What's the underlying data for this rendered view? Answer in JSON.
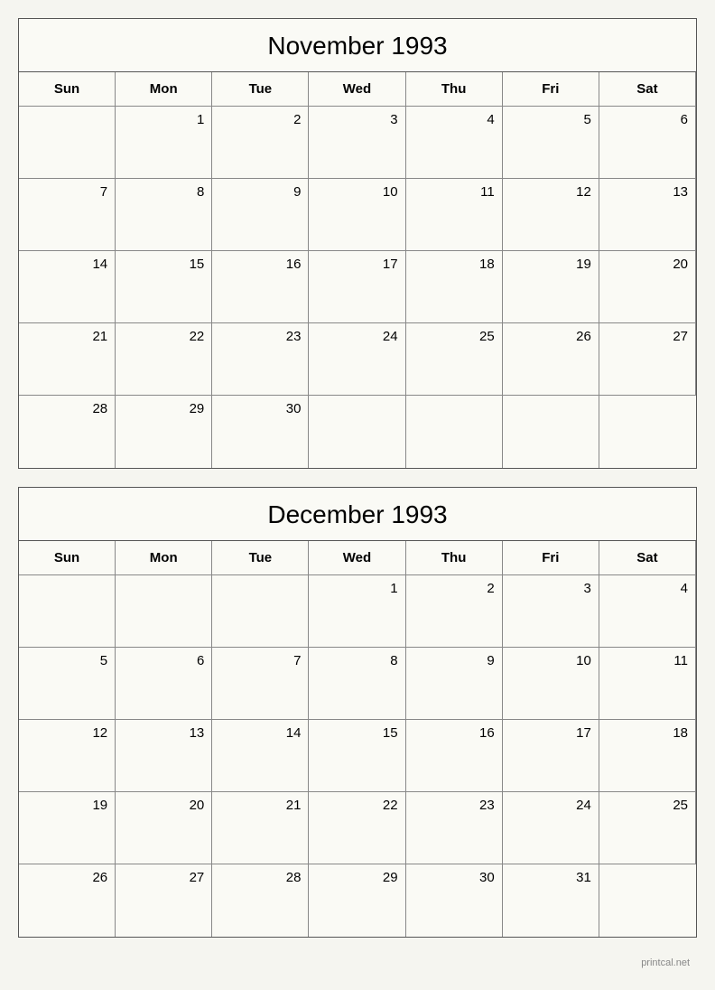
{
  "november": {
    "title": "November 1993",
    "headers": [
      "Sun",
      "Mon",
      "Tue",
      "Wed",
      "Thu",
      "Fri",
      "Sat"
    ],
    "weeks": [
      [
        "",
        "1",
        "2",
        "3",
        "4",
        "5",
        "6"
      ],
      [
        "7",
        "8",
        "9",
        "10",
        "11",
        "12",
        "13"
      ],
      [
        "14",
        "15",
        "16",
        "17",
        "18",
        "19",
        "20"
      ],
      [
        "21",
        "22",
        "23",
        "24",
        "25",
        "26",
        "27"
      ],
      [
        "28",
        "29",
        "30",
        "",
        "",
        "",
        ""
      ]
    ]
  },
  "december": {
    "title": "December 1993",
    "headers": [
      "Sun",
      "Mon",
      "Tue",
      "Wed",
      "Thu",
      "Fri",
      "Sat"
    ],
    "weeks": [
      [
        "",
        "",
        "",
        "1",
        "2",
        "3",
        "4"
      ],
      [
        "5",
        "6",
        "7",
        "8",
        "9",
        "10",
        "11"
      ],
      [
        "12",
        "13",
        "14",
        "15",
        "16",
        "17",
        "18"
      ],
      [
        "19",
        "20",
        "21",
        "22",
        "23",
        "24",
        "25"
      ],
      [
        "26",
        "27",
        "28",
        "29",
        "30",
        "31",
        ""
      ]
    ]
  },
  "watermark": "printcal.net"
}
